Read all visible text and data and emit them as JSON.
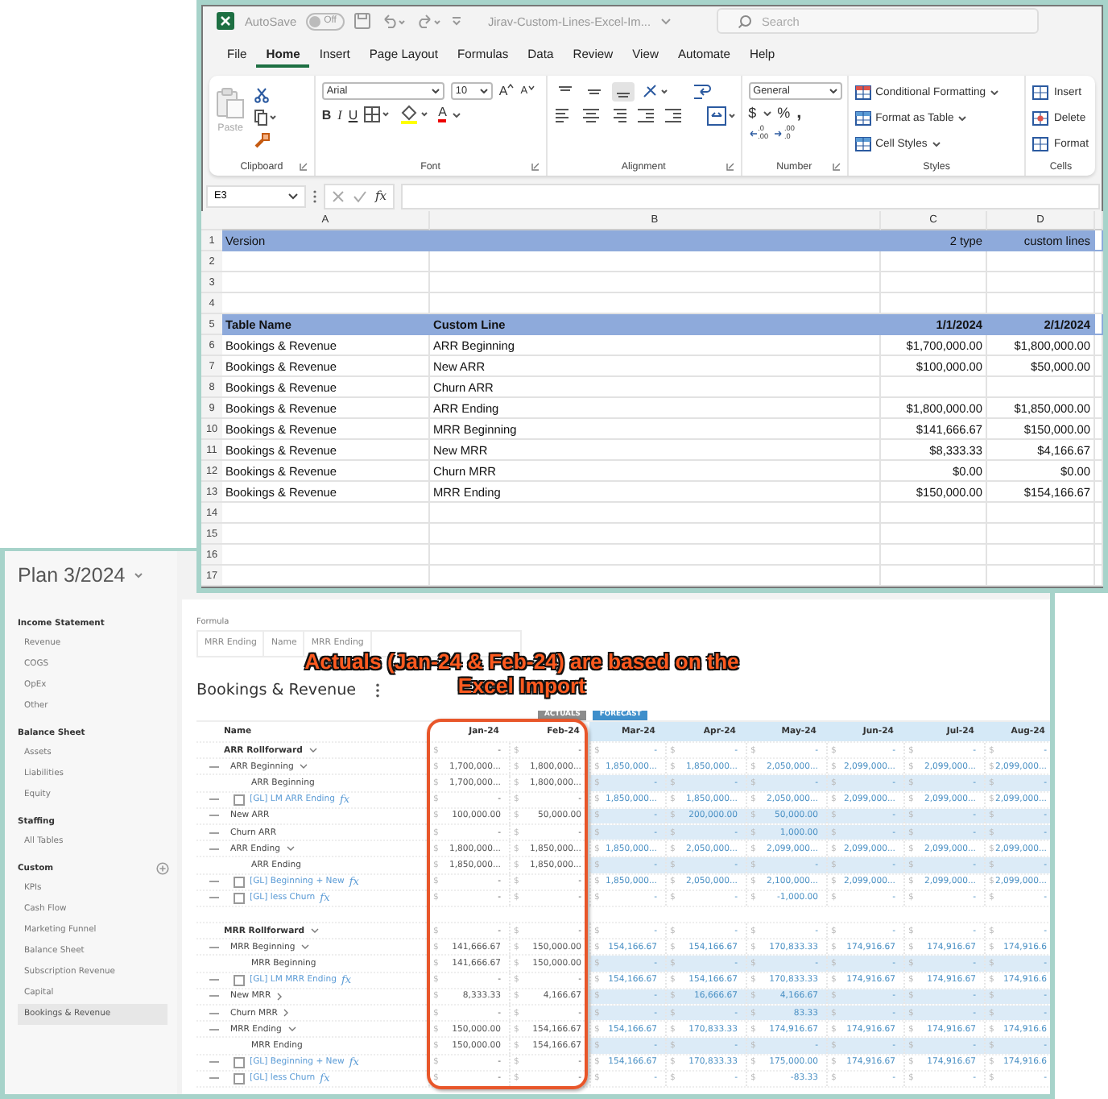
{
  "excel": {
    "title_bar": {
      "autosave_label": "AutoSave",
      "autosave_on": false,
      "toggle_text": "Off",
      "file_name": "Jirav-Custom-Lines-Excel-Im...",
      "search_placeholder": "Search"
    },
    "tabs": [
      {
        "label": "File",
        "selected": false
      },
      {
        "label": "Home",
        "selected": true
      },
      {
        "label": "Insert",
        "selected": false
      },
      {
        "label": "Page Layout",
        "selected": false
      },
      {
        "label": "Formulas",
        "selected": false
      },
      {
        "label": "Data",
        "selected": false
      },
      {
        "label": "Review",
        "selected": false
      },
      {
        "label": "View",
        "selected": false
      },
      {
        "label": "Automate",
        "selected": false
      },
      {
        "label": "Help",
        "selected": false
      }
    ],
    "ribbon": {
      "clipboard": {
        "paste": "Paste",
        "label": "Clipboard"
      },
      "font": {
        "family": "Arial",
        "size": "10",
        "grow": "A",
        "shrink": "A",
        "bold": "B",
        "italic": "I",
        "underline": "U",
        "color_letter": "A",
        "label": "Font"
      },
      "alignment": {
        "label": "Alignment"
      },
      "number": {
        "format": "General",
        "currency": "$",
        "percent": "%",
        "comma": ",",
        "decimals": [
          {
            "top": ".0",
            "bottom": ".00"
          },
          {
            "top": ".00",
            "bottom": ".0"
          }
        ],
        "label": "Number"
      },
      "styles": {
        "items": [
          "Conditional Formatting",
          "Format as Table",
          "Cell Styles"
        ],
        "label": "Styles"
      },
      "cells": {
        "items": [
          "Insert",
          "Delete",
          "Format"
        ],
        "label": "Cells"
      }
    },
    "formula_bar": {
      "name_box": "E3",
      "fx": "fx"
    },
    "columns": [
      "A",
      "B",
      "C",
      "D"
    ],
    "rows": [
      {
        "n": "1",
        "kind": "header",
        "bold": false,
        "cells": {
          "a": "Version",
          "c": "2 type",
          "d": "custom lines"
        }
      },
      {
        "n": "2",
        "kind": "empty"
      },
      {
        "n": "3",
        "kind": "empty"
      },
      {
        "n": "4",
        "kind": "empty"
      },
      {
        "n": "5",
        "kind": "header",
        "bold": true,
        "cells": {
          "a": "Table Name",
          "b": "Custom Line",
          "c": "1/1/2024",
          "d": "2/1/2024"
        }
      },
      {
        "n": "6",
        "kind": "data",
        "cells": {
          "a": "Bookings & Revenue",
          "b": "ARR Beginning",
          "c": "$1,700,000.00",
          "d": "$1,800,000.00"
        }
      },
      {
        "n": "7",
        "kind": "data",
        "cells": {
          "a": "Bookings & Revenue",
          "b": "New ARR",
          "c": "$100,000.00",
          "d": "$50,000.00"
        }
      },
      {
        "n": "8",
        "kind": "data",
        "cells": {
          "a": "Bookings & Revenue",
          "b": "Churn ARR"
        }
      },
      {
        "n": "9",
        "kind": "data",
        "cells": {
          "a": "Bookings & Revenue",
          "b": "ARR Ending",
          "c": "$1,800,000.00",
          "d": "$1,850,000.00"
        }
      },
      {
        "n": "10",
        "kind": "data",
        "cells": {
          "a": "Bookings & Revenue",
          "b": "MRR Beginning",
          "c": "$141,666.67",
          "d": "$150,000.00"
        }
      },
      {
        "n": "11",
        "kind": "data",
        "cells": {
          "a": "Bookings & Revenue",
          "b": "New MRR",
          "c": "$8,333.33",
          "d": "$4,166.67"
        }
      },
      {
        "n": "12",
        "kind": "data",
        "cells": {
          "a": "Bookings & Revenue",
          "b": "Churn MRR",
          "c": "$0.00",
          "d": "$0.00"
        }
      },
      {
        "n": "13",
        "kind": "data",
        "cells": {
          "a": "Bookings & Revenue",
          "b": "MRR Ending",
          "c": "$150,000.00",
          "d": "$154,166.67"
        }
      },
      {
        "n": "14",
        "kind": "empty"
      },
      {
        "n": "15",
        "kind": "empty"
      },
      {
        "n": "16",
        "kind": "empty"
      },
      {
        "n": "17",
        "kind": "empty"
      }
    ]
  },
  "app": {
    "plan_title": "Plan 3/2024",
    "sidebar": [
      {
        "title": "Income Statement",
        "has_add": false,
        "items": [
          {
            "label": "Revenue",
            "selected": false
          },
          {
            "label": "COGS",
            "selected": false
          },
          {
            "label": "OpEx",
            "selected": false
          },
          {
            "label": "Other",
            "selected": false
          }
        ]
      },
      {
        "title": "Balance Sheet",
        "has_add": false,
        "items": [
          {
            "label": "Assets",
            "selected": false
          },
          {
            "label": "Liabilities",
            "selected": false
          },
          {
            "label": "Equity",
            "selected": false
          }
        ]
      },
      {
        "title": "Staffing",
        "has_add": false,
        "items": [
          {
            "label": "All Tables",
            "selected": false
          }
        ]
      },
      {
        "title": "Custom",
        "has_add": true,
        "items": [
          {
            "label": "KPIs",
            "selected": false
          },
          {
            "label": "Cash Flow",
            "selected": false
          },
          {
            "label": "Marketing Funnel",
            "selected": false
          },
          {
            "label": "Balance Sheet",
            "selected": false
          },
          {
            "label": "Subscription Revenue",
            "selected": false
          },
          {
            "label": "Capital",
            "selected": false
          },
          {
            "label": "Bookings & Revenue",
            "selected": true
          }
        ]
      }
    ],
    "formula": {
      "label": "Formula",
      "fields": [
        "MRR Ending",
        "Name",
        "MRR Ending"
      ]
    },
    "annotation": [
      "Actuals (Jan-24 & Feb-24) are based on the",
      "Excel Import"
    ],
    "table_title": "Bookings & Revenue",
    "badges": {
      "actual": "ACTUALS",
      "forecast": "FORECAST"
    },
    "currency": "$",
    "columns": [
      {
        "label": "Name",
        "kind": "name"
      },
      {
        "label": "Jan-24",
        "kind": "actual"
      },
      {
        "label": "Feb-24",
        "kind": "actual"
      },
      {
        "label": "Mar-24",
        "kind": "forecast"
      },
      {
        "label": "Apr-24",
        "kind": "forecast"
      },
      {
        "label": "May-24",
        "kind": "forecast"
      },
      {
        "label": "Jun-24",
        "kind": "forecast"
      },
      {
        "label": "Jul-24",
        "kind": "forecast"
      },
      {
        "label": "Aug-24",
        "kind": "forecast"
      }
    ],
    "rows": [
      {
        "kind": "group",
        "name": "ARR Rollforward",
        "expanded": true,
        "input": false,
        "values": [
          "-",
          "-",
          "-",
          "-",
          "-",
          "-",
          "-",
          "-"
        ]
      },
      {
        "kind": "line",
        "name": "ARR Beginning",
        "expanded": true,
        "input": false,
        "values": [
          "1,700,000...",
          "1,800,000...",
          "1,850,000...",
          "1,850,000...",
          "2,050,000...",
          "2,099,000...",
          "2,099,000...",
          "2,099,000..."
        ]
      },
      {
        "kind": "subline",
        "name": "ARR Beginning",
        "input": true,
        "values": [
          "1,700,000...",
          "1,800,000...",
          "-",
          "-",
          "-",
          "-",
          "-",
          "-"
        ]
      },
      {
        "kind": "gl",
        "name": "[GL] LM ARR Ending",
        "fx": "fx",
        "checked": false,
        "input": false,
        "values": [
          "-",
          "-",
          "1,850,000...",
          "1,850,000...",
          "2,050,000...",
          "2,099,000...",
          "2,099,000...",
          "2,099,000..."
        ]
      },
      {
        "kind": "line",
        "name": "New ARR",
        "input": true,
        "values": [
          "100,000.00",
          "50,000.00",
          "-",
          "200,000.00",
          "50,000.00",
          "-",
          "-",
          "-"
        ]
      },
      {
        "kind": "line",
        "name": "Churn ARR",
        "input": true,
        "values": [
          "-",
          "-",
          "-",
          "-",
          "1,000.00",
          "-",
          "-",
          "-"
        ]
      },
      {
        "kind": "line",
        "name": "ARR Ending",
        "expanded": true,
        "input": false,
        "values": [
          "1,800,000...",
          "1,850,000...",
          "1,850,000...",
          "2,050,000...",
          "2,099,000...",
          "2,099,000...",
          "2,099,000...",
          "2,099,000..."
        ]
      },
      {
        "kind": "subline",
        "name": "ARR Ending",
        "input": true,
        "values": [
          "1,850,000...",
          "1,850,000...",
          "-",
          "-",
          "-",
          "-",
          "-",
          "-"
        ]
      },
      {
        "kind": "gl",
        "name": "[GL] Beginning + New",
        "fx": "fx",
        "checked": false,
        "input": false,
        "values": [
          "-",
          "-",
          "1,850,000...",
          "2,050,000...",
          "2,100,000...",
          "2,099,000...",
          "2,099,000...",
          "2,099,000..."
        ]
      },
      {
        "kind": "gl",
        "name": "[GL] less Churn",
        "fx": "fx",
        "checked": false,
        "input": false,
        "values": [
          "-",
          "-",
          "-",
          "-",
          "-1,000.00",
          "-",
          "-",
          "-"
        ]
      },
      {
        "kind": "blank"
      },
      {
        "kind": "group",
        "name": "MRR Rollforward",
        "expanded": true,
        "input": false,
        "values": [
          "-",
          "-",
          "-",
          "-",
          "-",
          "-",
          "-",
          "-"
        ]
      },
      {
        "kind": "line",
        "name": "MRR Beginning",
        "expanded": true,
        "input": false,
        "values": [
          "141,666.67",
          "150,000.00",
          "154,166.67",
          "154,166.67",
          "170,833.33",
          "174,916.67",
          "174,916.67",
          "174,916.6"
        ]
      },
      {
        "kind": "subline",
        "name": "MRR Beginning",
        "input": true,
        "values": [
          "141,666.67",
          "150,000.00",
          "-",
          "-",
          "-",
          "-",
          "-",
          "-"
        ]
      },
      {
        "kind": "gl",
        "name": "[GL] LM MRR Ending",
        "fx": "fx",
        "checked": false,
        "input": false,
        "values": [
          "-",
          "-",
          "154,166.67",
          "154,166.67",
          "170,833.33",
          "174,916.67",
          "174,916.67",
          "174,916.6"
        ]
      },
      {
        "kind": "line",
        "name": "New MRR",
        "expanded": false,
        "input": true,
        "values": [
          "8,333.33",
          "4,166.67",
          "-",
          "16,666.67",
          "4,166.67",
          "-",
          "-",
          "-"
        ]
      },
      {
        "kind": "line",
        "name": "Churn MRR",
        "expanded": false,
        "input": true,
        "values": [
          "-",
          "-",
          "-",
          "-",
          "83.33",
          "-",
          "-",
          "-"
        ]
      },
      {
        "kind": "line",
        "name": "MRR Ending",
        "expanded": true,
        "input": false,
        "values": [
          "150,000.00",
          "154,166.67",
          "154,166.67",
          "170,833.33",
          "174,916.67",
          "174,916.67",
          "174,916.67",
          "174,916.6"
        ]
      },
      {
        "kind": "subline",
        "name": "MRR Ending",
        "input": true,
        "values": [
          "150,000.00",
          "154,166.67",
          "-",
          "-",
          "-",
          "-",
          "-",
          "-"
        ]
      },
      {
        "kind": "gl",
        "name": "[GL] Beginning + New",
        "fx": "fx",
        "checked": false,
        "input": false,
        "values": [
          "-",
          "-",
          "154,166.67",
          "170,833.33",
          "175,000.00",
          "174,916.67",
          "174,916.67",
          "174,916.6"
        ]
      },
      {
        "kind": "gl",
        "name": "[GL] less Churn",
        "fx": "fx",
        "checked": false,
        "input": false,
        "values": [
          "-",
          "-",
          "-",
          "-",
          "-83.33",
          "-",
          "-",
          "-"
        ]
      }
    ]
  }
}
